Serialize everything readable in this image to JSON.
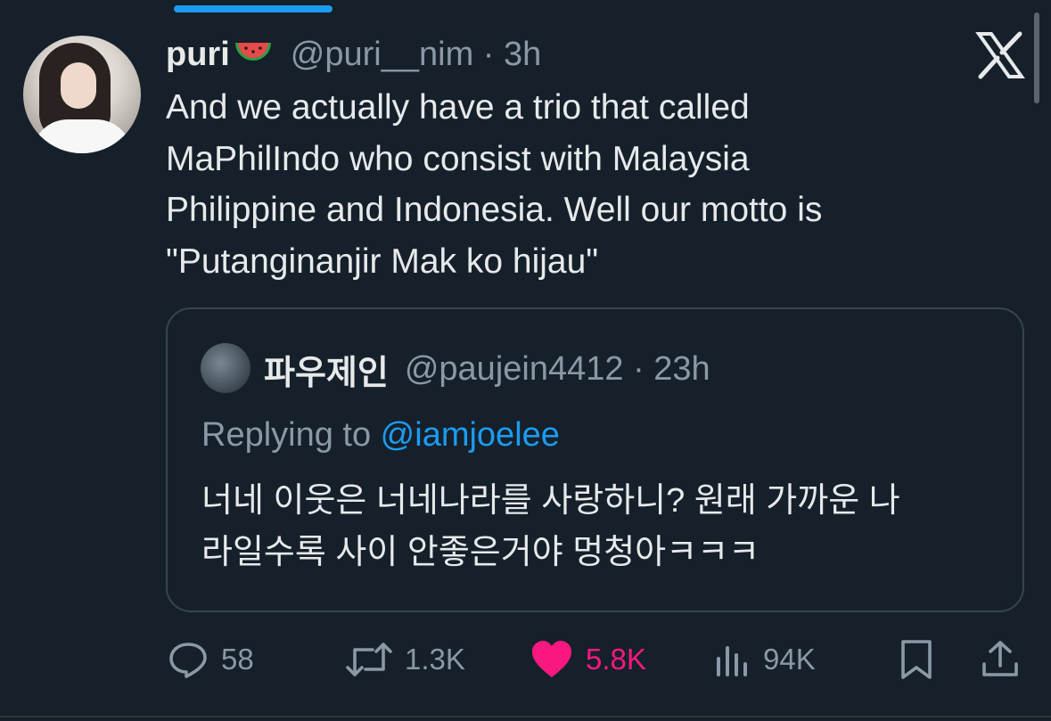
{
  "tweet": {
    "display_name": "puri",
    "emoji_name": "watermelon",
    "handle_time": "@puri__nim · 3h",
    "text": "And we actually have a trio that called\nMaPhilIndo who consist with Malaysia\nPhilippine and Indonesia. Well our motto is\n\"Putanginanjir Mak ko hijau\""
  },
  "quote": {
    "display_name": "파우제인",
    "handle_time": "@paujein4412 · 23h",
    "replying_prefix": "Replying to ",
    "replying_mention": "@iamjoelee",
    "text": "너네 이웃은 너네나라를 사랑하니? 원래 가까운 나\n라일수록 사이 안좋은거야 멍청아ㅋㅋㅋ"
  },
  "actions": {
    "replies": "58",
    "reposts": "1.3K",
    "likes": "5.8K",
    "views": "94K"
  },
  "colors": {
    "background": "#15202b",
    "accent": "#1d9bf0",
    "like": "#f91880",
    "muted": "#8b98a5"
  },
  "icons": [
    "x-logo-icon",
    "reply-icon",
    "repost-icon",
    "heart-icon",
    "views-icon",
    "bookmark-icon",
    "share-icon"
  ]
}
